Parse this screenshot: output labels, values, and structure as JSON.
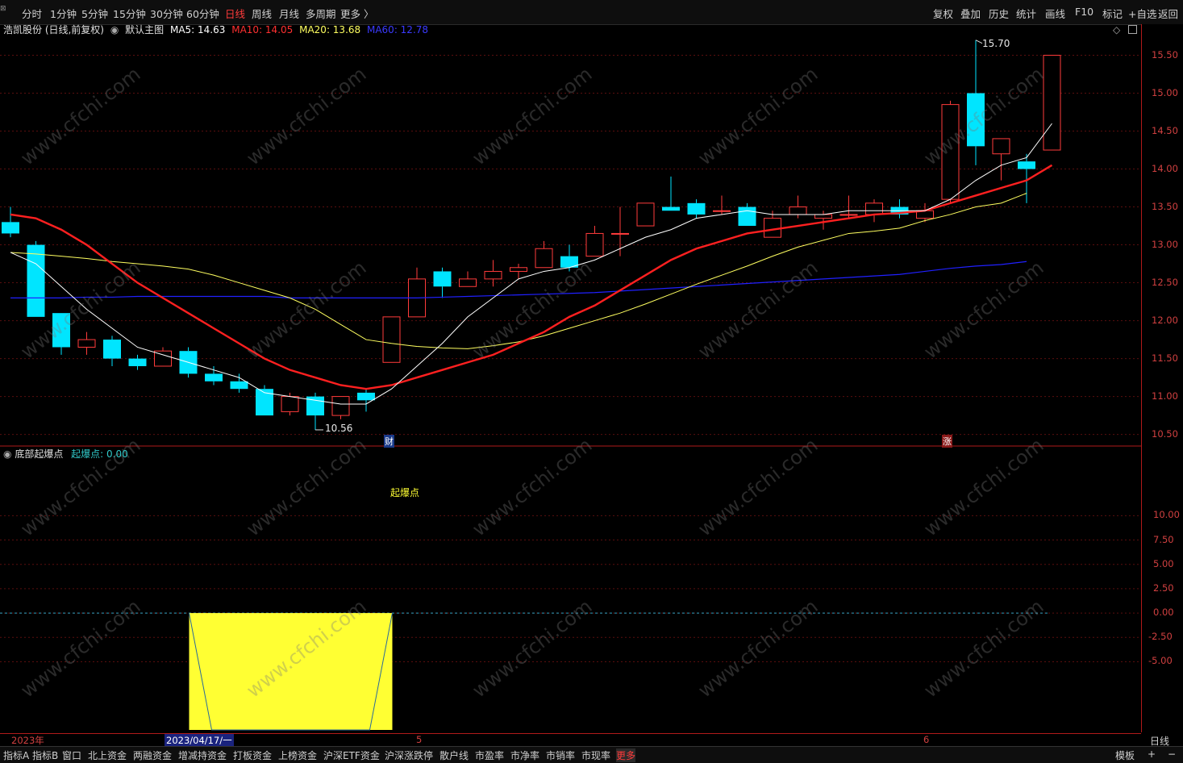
{
  "toolbar": {
    "periods": [
      "分时",
      "1分钟",
      "5分钟",
      "15分钟",
      "30分钟",
      "60分钟",
      "日线",
      "周线",
      "月线",
      "多周期",
      "更多 〉"
    ],
    "active_period": "日线",
    "right_buttons": [
      "复权",
      "叠加",
      "历史",
      "统计",
      "画线",
      "F10",
      "标记",
      "+自选",
      "返回"
    ]
  },
  "price_header": {
    "stock": "浩凯股份 (日线,前复权)",
    "template": "默认主图",
    "ma5": "MA5: 14.63",
    "ma10": "MA10: 14.05",
    "ma20": "MA20: 13.68",
    "ma60": "MA60: 12.78"
  },
  "indicator_header": {
    "name": "底部起爆点",
    "value": "起爆点: 0.00",
    "signal_label": "起爆点"
  },
  "annotations": {
    "high": "15.70",
    "low": "10.56",
    "cai": "财",
    "zhang": "涨"
  },
  "price_axis": [
    "15.50",
    "15.00",
    "14.50",
    "14.00",
    "13.50",
    "13.00",
    "12.50",
    "12.00",
    "11.50",
    "11.00",
    "10.50"
  ],
  "ind_axis": [
    "10.00",
    "7.50",
    "5.00",
    "2.50",
    "0.00",
    "-2.50",
    "-5.00"
  ],
  "dates": {
    "year": "2023年",
    "selected": "2023/04/17/一",
    "m5": "5",
    "m6": "6"
  },
  "period_label": "日线",
  "bottom_tabs": [
    "指标A",
    "指标B",
    "窗口",
    "北上资金",
    "两融资金",
    "增减持资金",
    "打板资金",
    "上榜资金",
    "沪深ETF资金",
    "沪深涨跌停",
    "散户线",
    "市盈率",
    "市净率",
    "市销率",
    "市现率",
    "更多"
  ],
  "bottom_right": [
    "模板",
    "+",
    "−"
  ],
  "watermark": "www.cfchi.com",
  "colors": {
    "up": "#ff3b3b",
    "down": "#00e5ff",
    "ma5": "#ffffff",
    "ma10": "#ff2020",
    "ma20": "#ffff60",
    "ma60": "#2020ff",
    "signal": "#ffff33"
  },
  "chart_data": {
    "type": "candlestick",
    "ylim": [
      10.4,
      15.75
    ],
    "candles": [
      {
        "o": 13.3,
        "h": 13.5,
        "l": 13.1,
        "c": 13.15
      },
      {
        "o": 13.0,
        "h": 13.05,
        "l": 12.05,
        "c": 12.05
      },
      {
        "o": 12.1,
        "h": 12.1,
        "l": 11.55,
        "c": 11.65
      },
      {
        "o": 11.65,
        "h": 11.85,
        "l": 11.55,
        "c": 11.75
      },
      {
        "o": 11.75,
        "h": 11.8,
        "l": 11.4,
        "c": 11.5
      },
      {
        "o": 11.5,
        "h": 11.55,
        "l": 11.35,
        "c": 11.4
      },
      {
        "o": 11.4,
        "h": 11.65,
        "l": 11.4,
        "c": 11.6
      },
      {
        "o": 11.6,
        "h": 11.65,
        "l": 11.25,
        "c": 11.3
      },
      {
        "o": 11.3,
        "h": 11.4,
        "l": 11.15,
        "c": 11.2
      },
      {
        "o": 11.2,
        "h": 11.3,
        "l": 11.05,
        "c": 11.1
      },
      {
        "o": 11.1,
        "h": 11.15,
        "l": 10.75,
        "c": 10.75
      },
      {
        "o": 10.8,
        "h": 11.05,
        "l": 10.75,
        "c": 11.0
      },
      {
        "o": 11.0,
        "h": 11.05,
        "l": 10.56,
        "c": 10.75
      },
      {
        "o": 10.75,
        "h": 11.0,
        "l": 10.7,
        "c": 11.0
      },
      {
        "o": 11.05,
        "h": 11.1,
        "l": 10.8,
        "c": 10.95
      },
      {
        "o": 11.45,
        "h": 12.05,
        "l": 11.45,
        "c": 12.05
      },
      {
        "o": 12.05,
        "h": 12.7,
        "l": 12.05,
        "c": 12.55
      },
      {
        "o": 12.65,
        "h": 12.7,
        "l": 12.3,
        "c": 12.45
      },
      {
        "o": 12.45,
        "h": 12.65,
        "l": 12.45,
        "c": 12.55
      },
      {
        "o": 12.55,
        "h": 12.8,
        "l": 12.45,
        "c": 12.65
      },
      {
        "o": 12.65,
        "h": 12.75,
        "l": 12.55,
        "c": 12.7
      },
      {
        "o": 12.7,
        "h": 13.05,
        "l": 12.7,
        "c": 12.95
      },
      {
        "o": 12.85,
        "h": 13.0,
        "l": 12.65,
        "c": 12.7
      },
      {
        "o": 12.85,
        "h": 13.25,
        "l": 12.85,
        "c": 13.15
      },
      {
        "o": 13.15,
        "h": 13.5,
        "l": 12.85,
        "c": 13.15
      },
      {
        "o": 13.25,
        "h": 13.55,
        "l": 13.25,
        "c": 13.55
      },
      {
        "o": 13.5,
        "h": 13.9,
        "l": 13.45,
        "c": 13.45
      },
      {
        "o": 13.55,
        "h": 13.6,
        "l": 13.35,
        "c": 13.4
      },
      {
        "o": 13.45,
        "h": 13.65,
        "l": 13.4,
        "c": 13.45
      },
      {
        "o": 13.5,
        "h": 13.55,
        "l": 13.25,
        "c": 13.25
      },
      {
        "o": 13.1,
        "h": 13.45,
        "l": 13.1,
        "c": 13.35
      },
      {
        "o": 13.4,
        "h": 13.65,
        "l": 13.35,
        "c": 13.5
      },
      {
        "o": 13.35,
        "h": 13.45,
        "l": 13.2,
        "c": 13.4
      },
      {
        "o": 13.4,
        "h": 13.65,
        "l": 13.35,
        "c": 13.4
      },
      {
        "o": 13.4,
        "h": 13.6,
        "l": 13.3,
        "c": 13.55
      },
      {
        "o": 13.5,
        "h": 13.6,
        "l": 13.35,
        "c": 13.4
      },
      {
        "o": 13.35,
        "h": 13.55,
        "l": 13.3,
        "c": 13.45
      },
      {
        "o": 13.6,
        "h": 14.9,
        "l": 13.55,
        "c": 14.85
      },
      {
        "o": 15.0,
        "h": 15.7,
        "l": 14.05,
        "c": 14.3
      },
      {
        "o": 14.2,
        "h": 14.4,
        "l": 13.85,
        "c": 14.4
      },
      {
        "o": 14.1,
        "h": 14.2,
        "l": 13.55,
        "c": 14.0
      },
      {
        "o": 14.25,
        "h": 15.5,
        "l": 14.25,
        "c": 15.5
      }
    ],
    "ma5": [
      12.9,
      12.75,
      12.45,
      12.15,
      11.9,
      11.65,
      11.55,
      11.45,
      11.35,
      11.25,
      11.05,
      11.0,
      10.95,
      10.9,
      10.9,
      11.1,
      11.4,
      11.7,
      12.05,
      12.3,
      12.55,
      12.65,
      12.7,
      12.8,
      12.95,
      13.1,
      13.2,
      13.35,
      13.4,
      13.45,
      13.4,
      13.4,
      13.4,
      13.45,
      13.45,
      13.45,
      13.45,
      13.6,
      13.85,
      14.05,
      14.15,
      14.6
    ],
    "ma10": [
      13.4,
      13.35,
      13.2,
      13.0,
      12.75,
      12.5,
      12.3,
      12.1,
      11.9,
      11.7,
      11.5,
      11.35,
      11.25,
      11.15,
      11.1,
      11.15,
      11.25,
      11.35,
      11.45,
      11.55,
      11.7,
      11.85,
      12.05,
      12.2,
      12.4,
      12.6,
      12.8,
      12.95,
      13.05,
      13.15,
      13.2,
      13.25,
      13.3,
      13.35,
      13.4,
      13.42,
      13.45,
      13.55,
      13.65,
      13.75,
      13.85,
      14.05
    ],
    "ma20": [
      12.9,
      12.88,
      12.85,
      12.82,
      12.78,
      12.75,
      12.72,
      12.68,
      12.6,
      12.5,
      12.4,
      12.3,
      12.15,
      11.95,
      11.75,
      11.7,
      11.66,
      11.64,
      11.63,
      11.67,
      11.72,
      11.8,
      11.9,
      12.0,
      12.1,
      12.22,
      12.35,
      12.48,
      12.6,
      12.72,
      12.85,
      12.97,
      13.06,
      13.15,
      13.18,
      13.22,
      13.32,
      13.4,
      13.5,
      13.55,
      13.68
    ],
    "ma60": [
      12.3,
      12.3,
      12.3,
      12.31,
      12.31,
      12.32,
      12.32,
      12.32,
      12.32,
      12.32,
      12.32,
      12.3,
      12.3,
      12.3,
      12.3,
      12.3,
      12.3,
      12.31,
      12.32,
      12.33,
      12.34,
      12.35,
      12.36,
      12.37,
      12.39,
      12.41,
      12.43,
      12.45,
      12.47,
      12.49,
      12.51,
      12.53,
      12.55,
      12.57,
      12.59,
      12.61,
      12.65,
      12.69,
      12.72,
      12.74,
      12.78
    ],
    "indicator": {
      "ylim": [
        -12,
        14.5
      ],
      "zero": 0,
      "block_from": 7,
      "block_to": 15,
      "block_low": -12
    }
  }
}
